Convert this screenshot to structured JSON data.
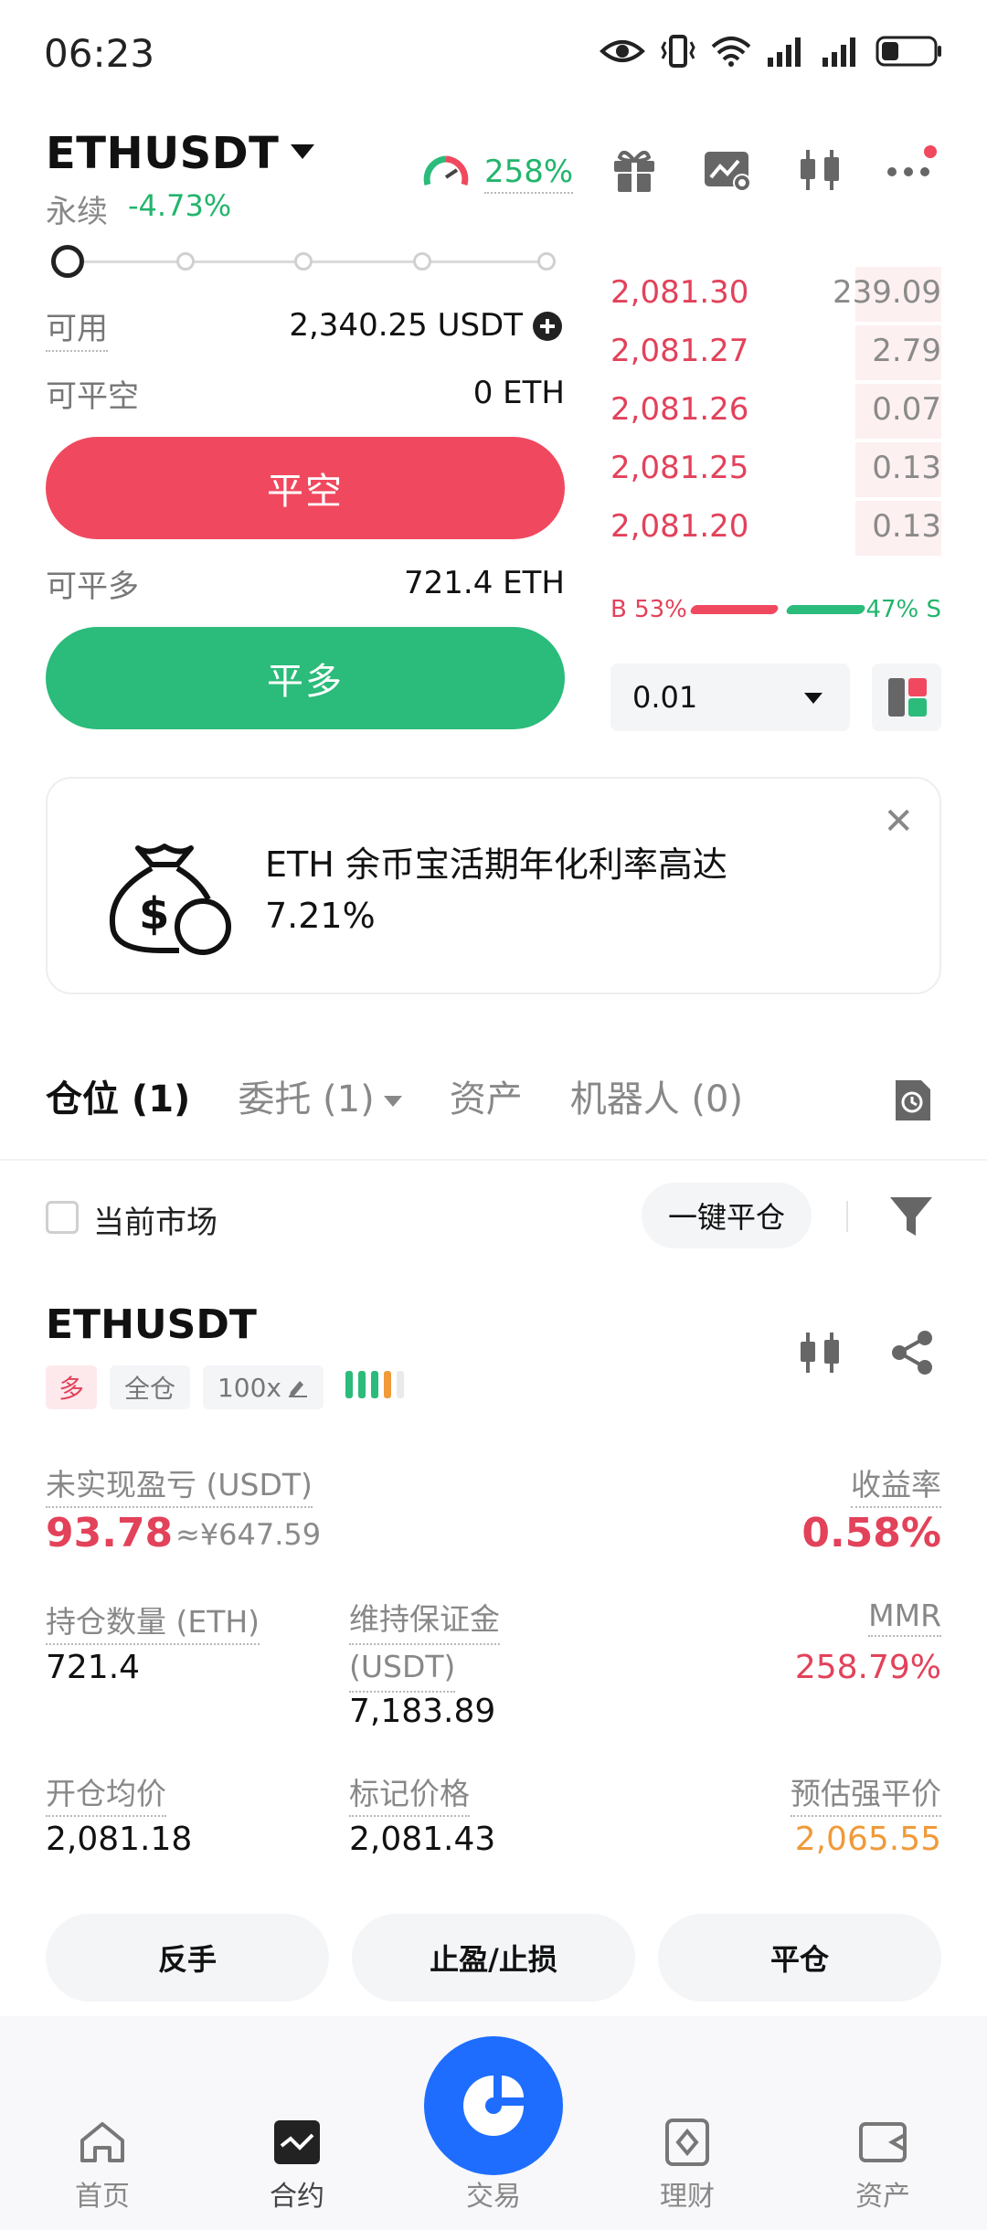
{
  "status_bar": {
    "time": "06:23"
  },
  "header": {
    "pair": "ETHUSDT",
    "contract_type": "永续",
    "change": "-4.73%",
    "gauge_percent": "258%"
  },
  "form": {
    "available_label": "可用",
    "available_value": "2,340.25 USDT",
    "close_short_label": "可平空",
    "close_short_value": "0 ETH",
    "close_short_button": "平空",
    "close_long_label": "可平多",
    "close_long_value": "721.4 ETH",
    "close_long_button": "平多"
  },
  "orderbook": {
    "asks": [
      {
        "price": "2,081.30",
        "qty": "239.09",
        "depth": 0.26
      },
      {
        "price": "2,081.27",
        "qty": "2.79",
        "depth": 0.26
      },
      {
        "price": "2,081.26",
        "qty": "0.07",
        "depth": 0.26
      },
      {
        "price": "2,081.25",
        "qty": "0.13",
        "depth": 0.26
      },
      {
        "price": "2,081.20",
        "qty": "0.13",
        "depth": 0.26
      }
    ],
    "buy_label": "B 53%",
    "sell_label": "47% S",
    "buy_ratio": 0.53,
    "depth_step": "0.01"
  },
  "promo": {
    "text_line1": "ETH 余币宝活期年化利率高达",
    "text_line2": "7.21%"
  },
  "tabs": {
    "positions": "仓位 (1)",
    "orders": "委托 (1)",
    "assets": "资产",
    "bots": "机器人 (0)"
  },
  "filters": {
    "current_market": "当前市场",
    "close_all": "一键平仓"
  },
  "position": {
    "symbol": "ETHUSDT",
    "side": "多",
    "margin_mode": "全仓",
    "leverage": "100x",
    "upnl_label": "未实现盈亏 (USDT)",
    "upnl_value": "93.78",
    "upnl_cny": "≈¥647.59",
    "roe_label": "收益率",
    "roe_value": "0.58%",
    "size_label": "持仓数量 (ETH)",
    "size_value": "721.4",
    "maint_margin_label_1": "维持保证金",
    "maint_margin_label_2": "(USDT)",
    "maint_margin_value": "7,183.89",
    "mmr_label": "MMR",
    "mmr_value": "258.79%",
    "entry_label": "开仓均价",
    "entry_value": "2,081.18",
    "mark_label": "标记价格",
    "mark_value": "2,081.43",
    "liq_label": "预估强平价",
    "liq_value": "2,065.55",
    "btn_reverse": "反手",
    "btn_tpsl": "止盈/止损",
    "btn_close": "平仓"
  },
  "nav": {
    "home": "首页",
    "futures": "合约",
    "trade": "交易",
    "earn": "理财",
    "assets": "资产"
  },
  "colors": {
    "red": "#f0495f",
    "green": "#2bbb7a",
    "blue": "#1e6dff",
    "orange": "#f09a3a"
  }
}
